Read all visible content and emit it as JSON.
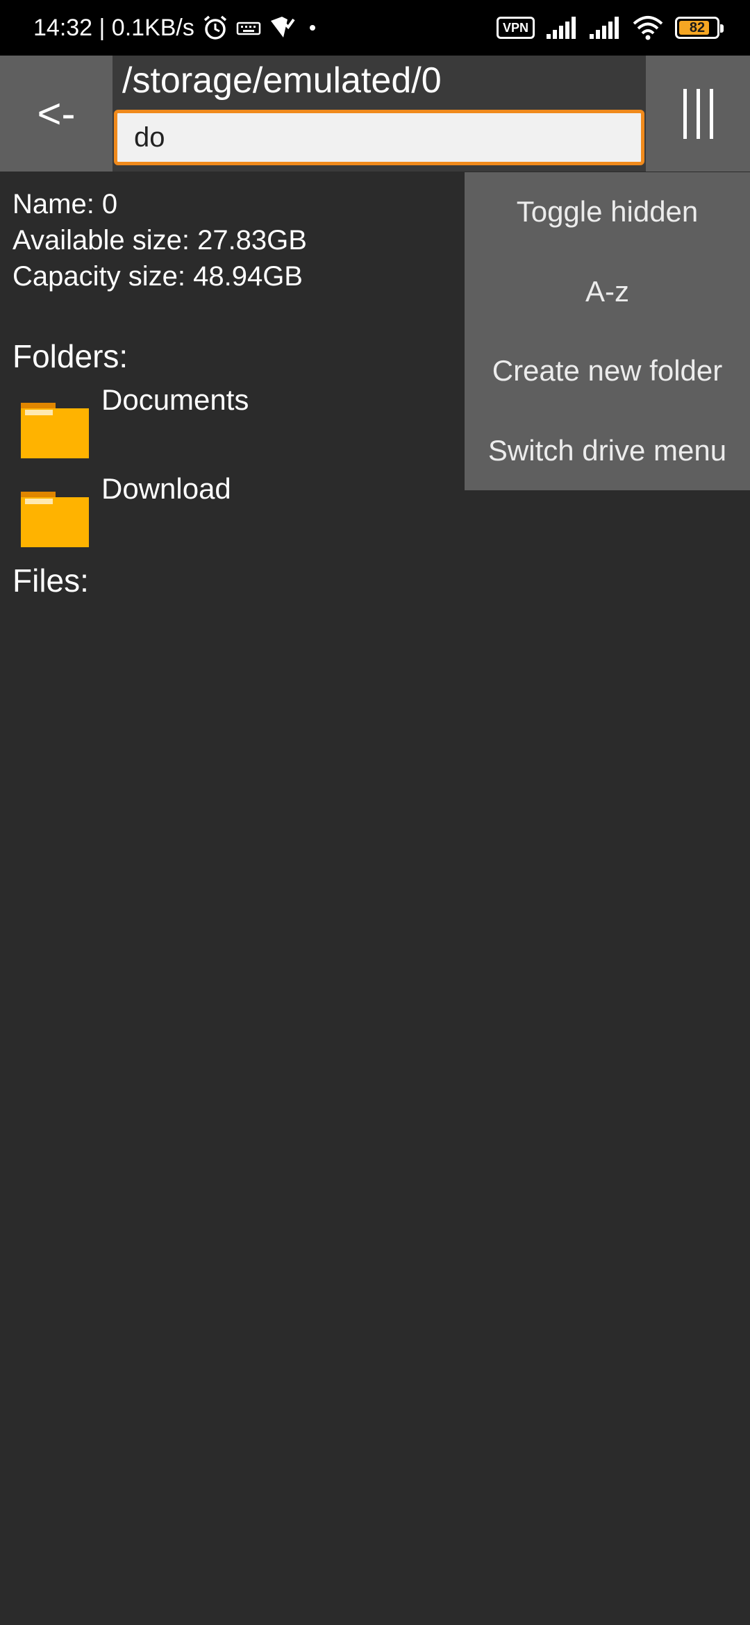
{
  "status_bar": {
    "time_speed": "14:32 | 0.1KB/s",
    "vpn_label": "VPN",
    "battery_level": "82",
    "battery_fraction": 0.82,
    "icons": [
      "alarm-icon",
      "keyboard-icon",
      "shield-check-icon",
      "notification-dot-icon",
      "signal-icon",
      "signal-icon",
      "wifi-icon",
      "battery-icon"
    ]
  },
  "header": {
    "back_label": "<-",
    "path": "/storage/emulated/0",
    "filter_value": "do"
  },
  "info": {
    "name": "Name: 0",
    "available": "Available size: 27.83GB",
    "capacity": "Capacity size: 48.94GB"
  },
  "sections": {
    "folders_label": "Folders:",
    "files_label": "Files:"
  },
  "folders": [
    {
      "name": "Documents"
    },
    {
      "name": "Download"
    }
  ],
  "menu": {
    "items": [
      {
        "label": "Toggle hidden"
      },
      {
        "label": "A-z"
      },
      {
        "label": "Create new folder"
      },
      {
        "label": "Switch drive menu"
      }
    ]
  },
  "colors": {
    "accent": "#f08a1c",
    "folder": "#ffb300",
    "folder_tab": "#e08600",
    "background": "#2b2b2b",
    "panel": "#5f5f5f"
  }
}
